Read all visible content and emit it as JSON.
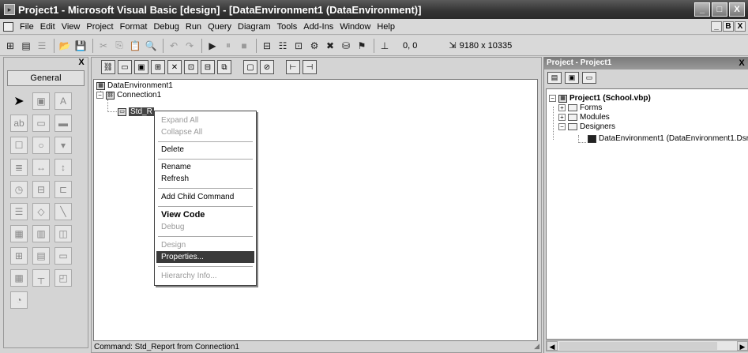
{
  "window": {
    "title": "Project1 - Microsoft Visual Basic [design] - [DataEnvironment1 (DataEnvironment)]",
    "controls": [
      "_",
      "□",
      "X"
    ]
  },
  "menubar": {
    "items": [
      "File",
      "Edit",
      "View",
      "Project",
      "Format",
      "Debug",
      "Run",
      "Query",
      "Diagram",
      "Tools",
      "Add-Ins",
      "Window",
      "Help"
    ],
    "mdi_controls": [
      "_",
      "B",
      "X"
    ]
  },
  "toolbar": {
    "coords": "0, 0",
    "size": "9180 x 10335"
  },
  "toolbox": {
    "tab_label": "General",
    "close": "X",
    "tools": [
      "pointer-icon",
      "picturebox-icon",
      "label-icon",
      "textbox-icon",
      "frame-icon",
      "commandbutton-icon",
      "checkbox-icon",
      "optionbutton-icon",
      "combobox-icon",
      "listbox-icon",
      "hscroll-icon",
      "vscroll-icon",
      "timer-icon",
      "drivelist-icon",
      "dirlist-icon",
      "filelist-icon",
      "shape-icon",
      "line-icon",
      "image-icon",
      "data-icon",
      "ole-icon",
      "grid-icon",
      "datagrid-icon",
      "datacombo-icon",
      "hierflexgrid-icon",
      "chart-icon",
      "repeater-icon",
      "ado-icon"
    ]
  },
  "designer": {
    "tree": {
      "root": "DataEnvironment1",
      "connection": "Connection1",
      "command": "Std_R"
    },
    "status": "Command: Std_Report from Connection1"
  },
  "context_menu": {
    "expand_all": "Expand All",
    "collapse_all": "Collapse All",
    "delete": "Delete",
    "rename": "Rename",
    "refresh": "Refresh",
    "add_child_command": "Add Child Command",
    "view_code": "View Code",
    "debug": "Debug",
    "design": "Design",
    "properties": "Properties...",
    "hierarchy_info": "Hierarchy Info..."
  },
  "project_panel": {
    "title": "Project - Project1",
    "close": "X",
    "project_label": "Project1 (School.vbp)",
    "forms": "Forms",
    "modules": "Modules",
    "designers": "Designers",
    "designer_item": "DataEnvironment1 (DataEnvironment1.Dsr"
  }
}
